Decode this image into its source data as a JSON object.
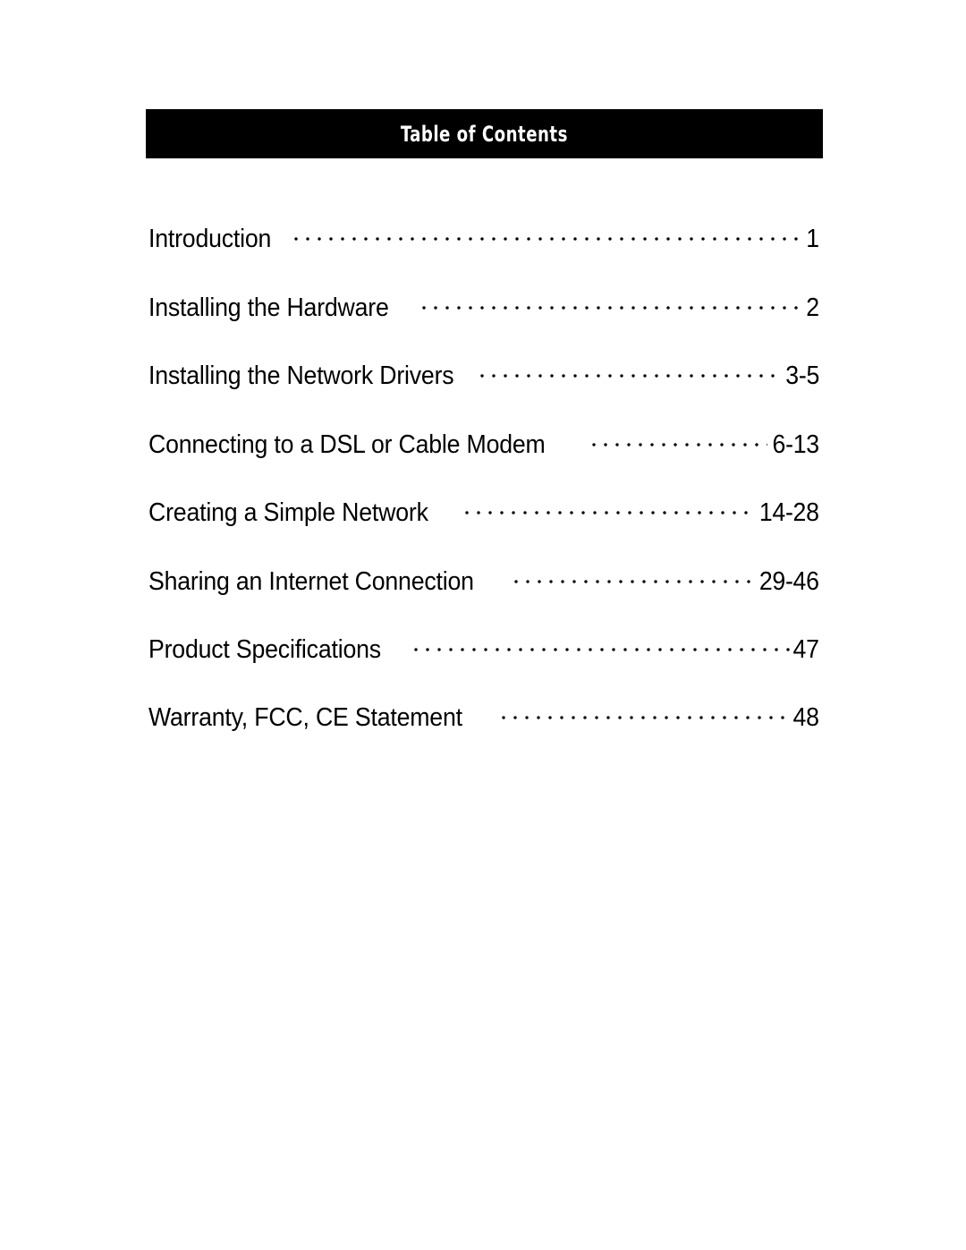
{
  "document": {
    "title": "Table of Contents",
    "background_color": "#ffffff",
    "text_color": "#000000"
  },
  "header": {
    "title": "Table of Contents",
    "bar_color": "#000000",
    "title_color": "#ffffff"
  },
  "toc": {
    "leader_char": ".",
    "entries": [
      {
        "label": "Introduction",
        "page": "1"
      },
      {
        "label": "Installing the Hardware",
        "page": "2"
      },
      {
        "label": "Installing the Network Drivers",
        "page": "3-5"
      },
      {
        "label": "Connecting to a DSL or Cable Modem",
        "page": "6-13"
      },
      {
        "label": "Creating a Simple Network",
        "page": "14-28"
      },
      {
        "label": "Sharing an Internet Connection",
        "page": "29-46"
      },
      {
        "label": "Product Specifications",
        "page": "47"
      },
      {
        "label": "Warranty, FCC, CE Statement",
        "page": "48"
      }
    ]
  }
}
